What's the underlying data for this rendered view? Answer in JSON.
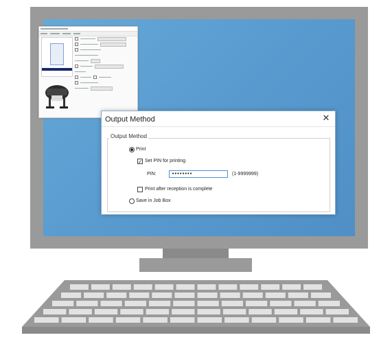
{
  "dialog": {
    "title": "Output Method",
    "close_glyph": "✕",
    "group_label": "Output Method",
    "print_label": "Print",
    "set_pin_label": "Set PIN for printing",
    "set_pin_checked": true,
    "set_pin_check_glyph": "✓",
    "pin_label": "PIN:",
    "pin_value": "••••••••",
    "pin_range": "(1-9999999)",
    "print_after_label": "Print after reception is complete",
    "print_after_checked": false,
    "save_job_box_label": "Save in Job Box",
    "selected_output": "Print"
  },
  "background_window": {
    "description_icons": [
      "printer-icon",
      "page-preview"
    ]
  }
}
